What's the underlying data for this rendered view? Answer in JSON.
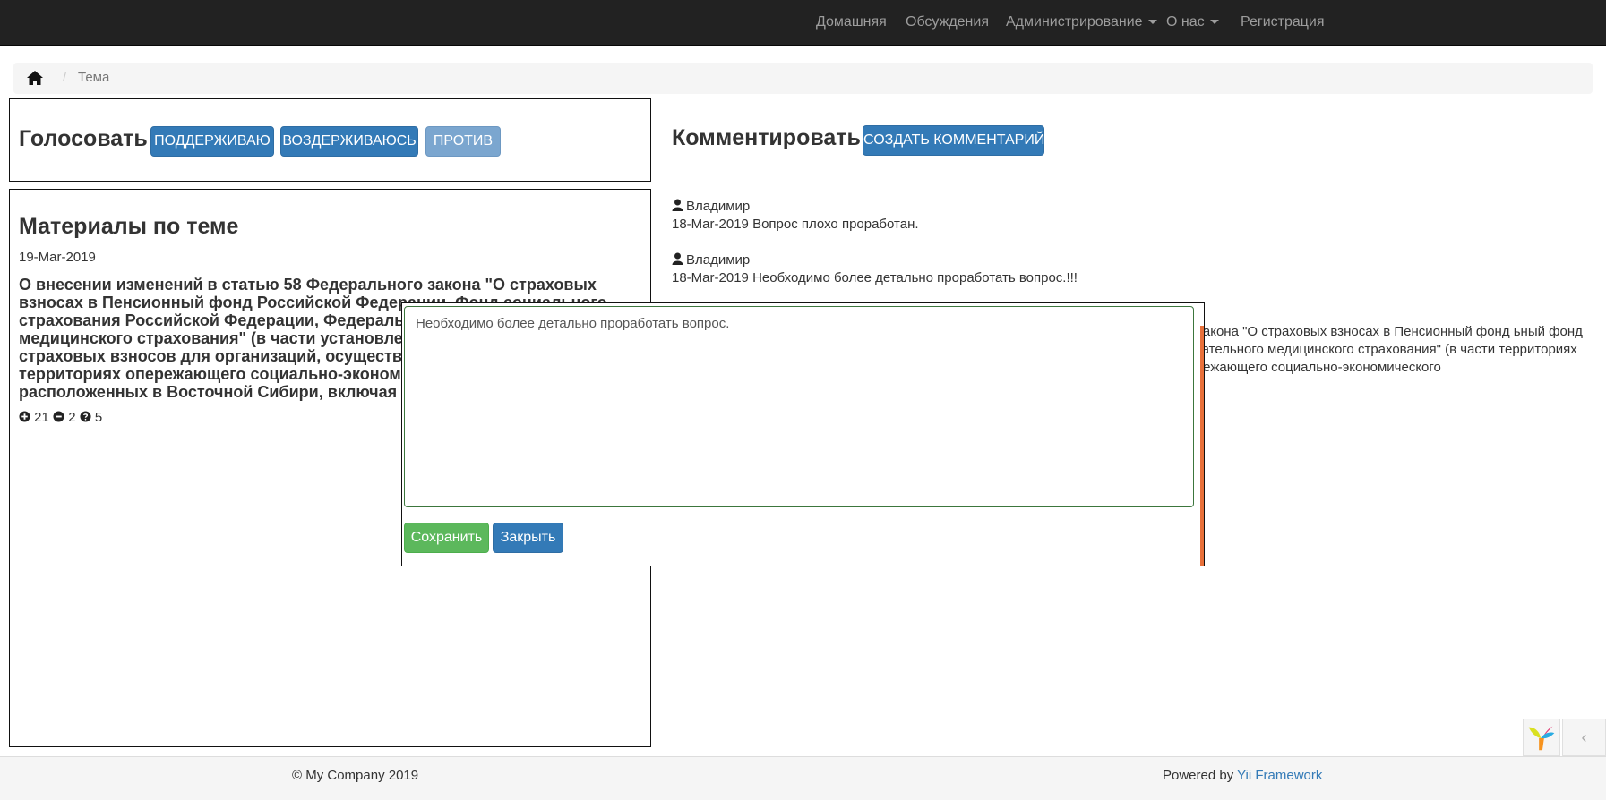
{
  "nav": {
    "items": [
      {
        "label": "Домашняя",
        "has_caret": false
      },
      {
        "label": "Обсуждения",
        "has_caret": false
      },
      {
        "label": "Администрирование",
        "has_caret": true
      },
      {
        "label": "О нас",
        "has_caret": true
      },
      {
        "label": "Регистрация",
        "has_caret": false
      }
    ]
  },
  "breadcrumb": {
    "home_icon": "home-icon",
    "separator": "/",
    "current": "Тема"
  },
  "vote": {
    "title": "Голосовать",
    "support_label": "ПОДДЕРЖИВАЮ",
    "abstain_label": "ВОЗДЕРЖИВАЮСЬ",
    "against_label": "ПРОТИВ"
  },
  "materials": {
    "title": "Материалы по теме",
    "date": "19-Mar-2019",
    "text": "О внесении изменений в статью 58 Федерального закона \"О страховых взносах в Пенсионный фонд Российской Федерации, Фонд социального страхования Российской Федерации, Федеральный фонд обязательного медицинского страхования\" (в части установления пониженных тарифов страховых взносов для организаций, осуществляющих деятельность на территориях опережающего социально-экономического развития, расположенных в Восточной Сибири, включая Республику Хакасия)",
    "stats": {
      "plus_icon": "plus-circle-icon",
      "plus": "21",
      "minus_icon": "minus-circle-icon",
      "minus": "2",
      "question_icon": "question-circle-icon",
      "question": "5"
    }
  },
  "comments": {
    "title": "Комментировать",
    "create_label": "СОЗДАТЬ КОММЕНТАРИЙ",
    "items": [
      {
        "author": "Владимир",
        "date": "18-Mar-2019",
        "text": "Вопрос плохо проработан."
      },
      {
        "author": "Владимир",
        "date": "18-Mar-2019",
        "text": "Необходимо более детально проработать вопрос.!!!"
      }
    ],
    "partial_text": "ого закона \"О страховых взносах в Пенсионный фонд ьный фонд обязательного медицинского страхования\" (в части территориях опережающего социально-экономического"
  },
  "modal": {
    "textarea_value": "Необходимо более детально проработать вопрос.",
    "save_label": "Сохранить",
    "close_label": "Закрыть"
  },
  "footer": {
    "copyright": "© My Company 2019",
    "powered_prefix": "Powered by ",
    "powered_link": "Yii Framework"
  },
  "debug": {
    "logo_icon": "yii-logo-icon",
    "toggle_glyph": "‹"
  },
  "colors": {
    "navbar_bg": "#222222",
    "primary": "#337ab7",
    "success": "#5cb85c",
    "link": "#337ab7"
  }
}
